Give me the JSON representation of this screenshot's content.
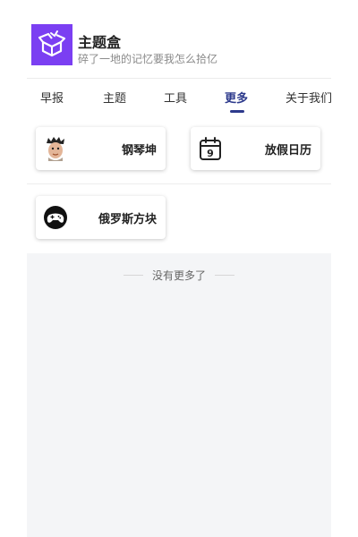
{
  "header": {
    "title": "主题盒",
    "subtitle": "碎了一地的记忆要我怎么拾亿",
    "logo_color": "#7b3ff2",
    "logo_icon": "open-box-icon"
  },
  "tabs": [
    {
      "label": "早报",
      "active": false
    },
    {
      "label": "主题",
      "active": false
    },
    {
      "label": "工具",
      "active": false
    },
    {
      "label": "更多",
      "active": true
    },
    {
      "label": "关于我们",
      "active": false
    }
  ],
  "tools": [
    {
      "label": "钢琴坤",
      "icon": "avatar-face-icon"
    },
    {
      "label": "放假日历",
      "icon": "calendar-icon",
      "icon_text": "9"
    },
    {
      "label": "俄罗斯方块",
      "icon": "gamepad-icon"
    }
  ],
  "footer": {
    "end_text": "没有更多了"
  },
  "colors": {
    "accent": "#2d3a8c",
    "background": "#f4f5f7"
  }
}
